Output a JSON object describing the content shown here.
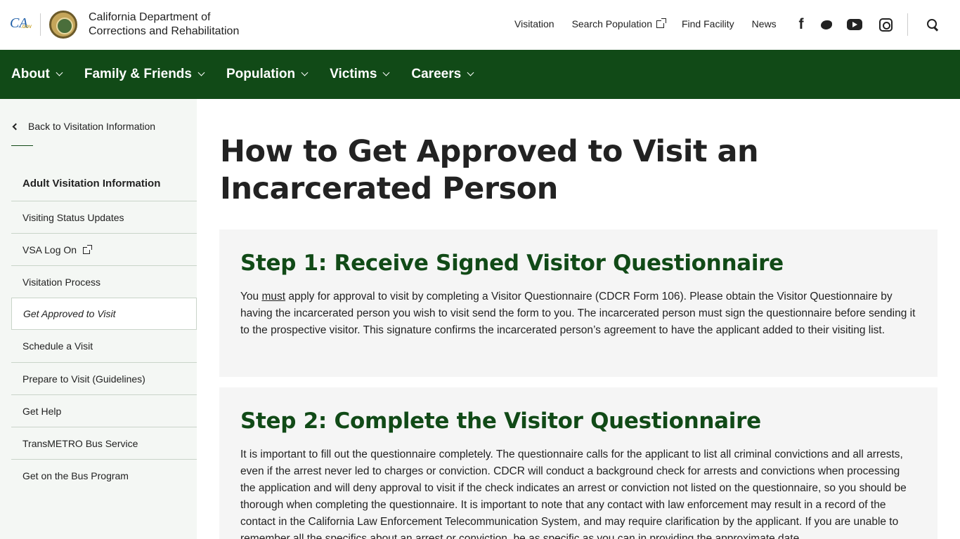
{
  "header": {
    "ca_logo_text": "CA",
    "ca_logo_sub": ".GOV",
    "agency_line1": "California Department of",
    "agency_line2": "Corrections and Rehabilitation",
    "links": [
      "Visitation",
      "Search Population",
      "Find Facility",
      "News"
    ],
    "social_icons": [
      "facebook-icon",
      "twitter-icon",
      "youtube-icon",
      "instagram-icon"
    ],
    "facebook_glyph": "f"
  },
  "main_nav": [
    "About",
    "Family & Friends",
    "Population",
    "Victims",
    "Careers"
  ],
  "sidebar": {
    "back_link": "Back to Visitation Information",
    "title": "Adult Visitation Information",
    "items": [
      "Visiting Status Updates",
      "VSA Log On",
      "Visitation Process",
      "Get Approved to Visit",
      "Schedule a Visit",
      "Prepare to Visit (Guidelines)",
      "Get Help",
      "TransMETRO Bus Service",
      "Get on the Bus Program"
    ],
    "active_index": 3
  },
  "main": {
    "title": "How to Get Approved to Visit an Incarcerated Person",
    "step1": {
      "heading": "Step 1: Receive Signed Visitor Questionnaire",
      "body_before": "You ",
      "body_emphasis": "must",
      "body_after": " apply for approval to visit by completing a Visitor Questionnaire (CDCR Form 106). Please obtain the Visitor Questionnaire by having the incarcerated person you wish to visit send the form to you. The incarcerated person must sign the questionnaire before sending it to the prospective visitor. This signature confirms the incarcerated person’s agreement to have the applicant added to their visiting list."
    },
    "step2": {
      "heading": "Step 2: Complete the Visitor Questionnaire",
      "body": "It is important to fill out the questionnaire completely. The questionnaire calls for the applicant to list all criminal convictions and all arrests, even if the arrest never led to charges or conviction. CDCR will conduct a background check for arrests and convictions when processing the application and will deny approval to visit if the check indicates an arrest or conviction not listed on the questionnaire, so you should be thorough when completing the questionnaire. It is important to note that any contact with law enforcement may result in a record of the contact in the California Law Enforcement Telecommunication System, and may require clarification by the applicant. If you are unable to remember all the specifics about an arrest or conviction, be as specific as you can in providing the approximate date"
    }
  },
  "colors": {
    "brand_green": "#114a17",
    "card_bg": "#f5f5f5",
    "sidebar_bg": "#f4f7f4"
  }
}
